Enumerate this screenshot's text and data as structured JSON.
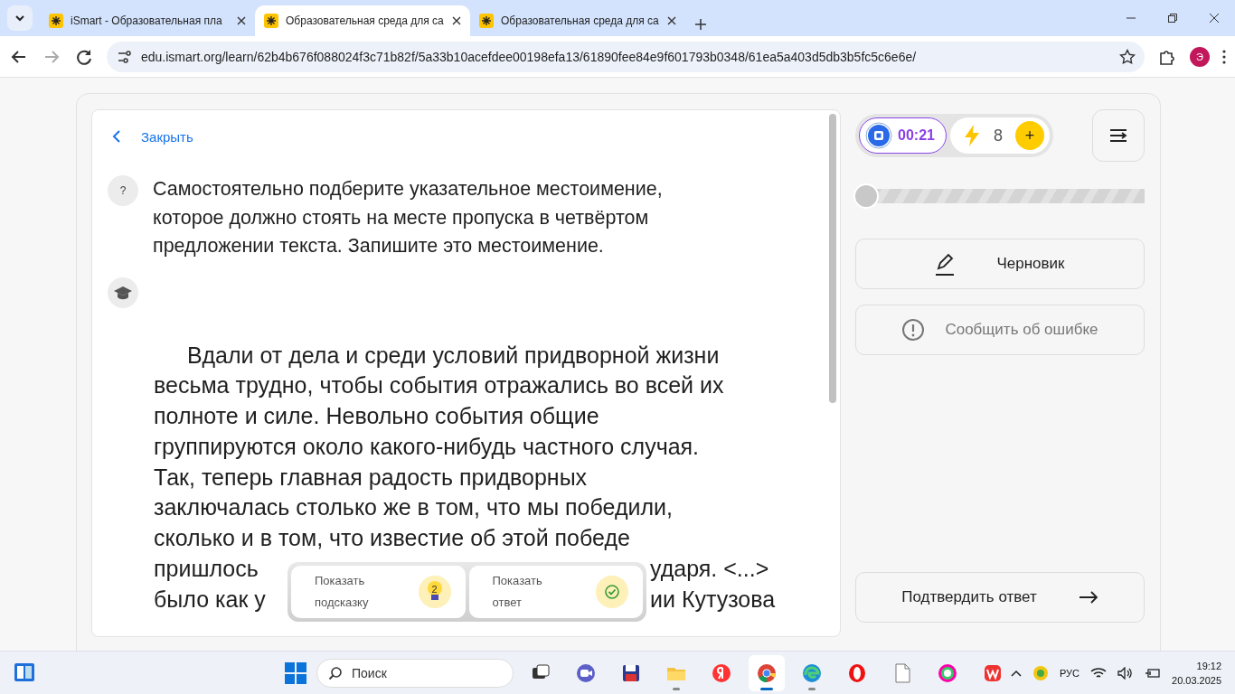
{
  "browser": {
    "tabs": [
      {
        "title": "iSmart - Образовательная пла",
        "selected": false
      },
      {
        "title": "Образовательная среда для са",
        "selected": true
      },
      {
        "title": "Образовательная среда для са",
        "selected": false
      }
    ],
    "url": "edu.ismart.org/learn/62b4b676f088024f3c71b82f/5a33b10acefdee00198efa13/61890fee84e9f601793b0348/61ea5a403d5db3b5fc5c6e6e/",
    "profile": "Э"
  },
  "task": {
    "close_label": "Закрыть",
    "question_mark": "?",
    "question": "Самостоятельно подберите указательное местоимение, которое должно стоять на месте пропуска в четвёртом предложении текста. Запишите это местоимение.",
    "passage": [
      {
        "segments": [
          "Вдали от дела и среди условий придворной жизни"
        ]
      },
      {
        "segments": [
          "весьма трудно, чтобы события отражались во всей их"
        ]
      },
      {
        "segments": [
          "полноте и силе. Невольно события общие"
        ]
      },
      {
        "segments": [
          "группируются около какого-нибудь частного случая."
        ]
      },
      {
        "segments": [
          "Так, теперь главная радость придворных"
        ]
      },
      {
        "segments": [
          "заключалась столько же в том, что мы победили,"
        ]
      },
      {
        "segments": [
          "сколько и в том, что известие об этой победе"
        ]
      },
      {
        "segments": [
          "пришлось",
          "ударя. <...>"
        ]
      },
      {
        "segments": [
          "было как у",
          "ии Кутузова"
        ]
      }
    ]
  },
  "hint_bar": [
    {
      "kind": "hint",
      "label": "Показать подсказку",
      "badge": "2"
    },
    {
      "kind": "answer",
      "label": "Показать ответ"
    }
  ],
  "sidebar": {
    "timer": "00:21",
    "energy": "8",
    "energy_add": "+",
    "progress": {
      "level": 0
    },
    "draft_label": "Черновик",
    "report_label": "Сообщить об ошибке",
    "submit_label": "Подтвердить ответ"
  },
  "taskbar": {
    "search_placeholder": "Поиск",
    "apps": [
      {
        "kind": "taskview",
        "running": false,
        "selected": false
      },
      {
        "kind": "meet",
        "running": false,
        "selected": false
      },
      {
        "kind": "disk",
        "running": false,
        "selected": false
      },
      {
        "kind": "folder",
        "running": true,
        "selected": false
      },
      {
        "kind": "yandex",
        "running": false,
        "selected": false
      },
      {
        "kind": "chrome",
        "running": true,
        "selected": true
      },
      {
        "kind": "edge",
        "running": true,
        "selected": false
      },
      {
        "kind": "opera",
        "running": false,
        "selected": false
      },
      {
        "kind": "file",
        "running": false,
        "selected": false
      },
      {
        "kind": "pinwheel",
        "running": false,
        "selected": false
      },
      {
        "kind": "office",
        "running": false,
        "selected": false
      }
    ],
    "language": "РУС",
    "time": "19:12",
    "date": "20.03.2025"
  }
}
